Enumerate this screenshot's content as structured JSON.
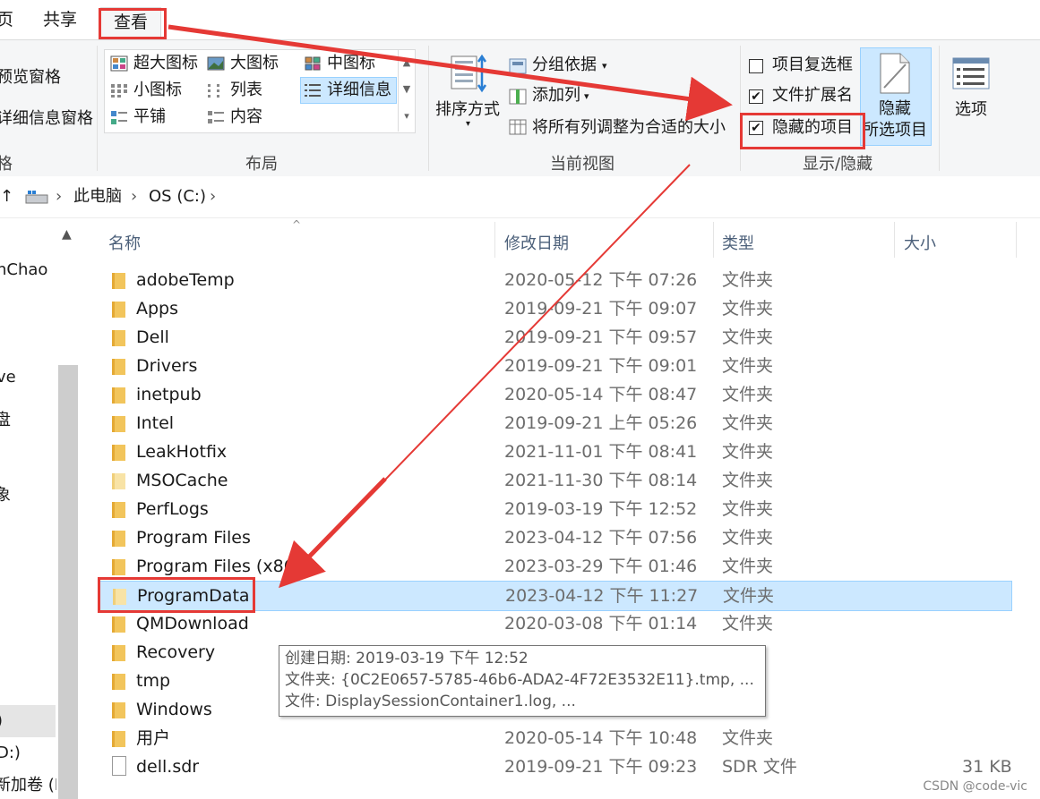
{
  "tabs": {
    "partial": "页",
    "share": "共享",
    "view": "查看"
  },
  "ribbon": {
    "pane_group": {
      "preview_pane": "预览窗格",
      "details_pane": "详细信息窗格",
      "group_label": "格"
    },
    "layout": {
      "items": [
        "超大图标",
        "大图标",
        "中图标",
        "小图标",
        "列表",
        "详细信息",
        "平铺",
        "内容"
      ],
      "group_label": "布局"
    },
    "current_view": {
      "sort_by": "排序方式",
      "group_by": "分组依据",
      "add_columns": "添加列",
      "size_all_columns": "将所有列调整为合适的大小",
      "group_label": "当前视图"
    },
    "show_hide": {
      "item_checkboxes": {
        "label": "项目复选框",
        "checked": false
      },
      "file_name_extensions": {
        "label": "文件扩展名",
        "checked": true
      },
      "hidden_items": {
        "label": "隐藏的项目",
        "checked": true
      },
      "hide_selected_line1": "隐藏",
      "hide_selected_line2": "所选项目",
      "group_label": "显示/隐藏"
    },
    "options": "选项"
  },
  "address": {
    "up_arrow": "↑",
    "crumb1": "此电脑",
    "crumb2": "OS (C:)"
  },
  "nav": {
    "items": [
      "nChao",
      "ve",
      "盘",
      "象",
      ")",
      "D:)",
      "新加卷 (E"
    ]
  },
  "columns": {
    "name": "名称",
    "modified": "修改日期",
    "type": "类型",
    "size": "大小"
  },
  "files": [
    {
      "name": "adobeTemp",
      "date": "2020-05-12 下午 07:26",
      "type": "文件夹",
      "size": "",
      "kind": "folder"
    },
    {
      "name": "Apps",
      "date": "2019-09-21 下午 09:07",
      "type": "文件夹",
      "size": "",
      "kind": "folder"
    },
    {
      "name": "Dell",
      "date": "2019-09-21 下午 09:57",
      "type": "文件夹",
      "size": "",
      "kind": "folder"
    },
    {
      "name": "Drivers",
      "date": "2019-09-21 下午 09:01",
      "type": "文件夹",
      "size": "",
      "kind": "folder"
    },
    {
      "name": "inetpub",
      "date": "2020-05-14 下午 08:47",
      "type": "文件夹",
      "size": "",
      "kind": "folder"
    },
    {
      "name": "Intel",
      "date": "2019-09-21 上午 05:26",
      "type": "文件夹",
      "size": "",
      "kind": "folder"
    },
    {
      "name": "LeakHotfix",
      "date": "2021-11-01 下午 08:41",
      "type": "文件夹",
      "size": "",
      "kind": "folder"
    },
    {
      "name": "MSOCache",
      "date": "2021-11-30 下午 08:14",
      "type": "文件夹",
      "size": "",
      "kind": "hidden"
    },
    {
      "name": "PerfLogs",
      "date": "2019-03-19 下午 12:52",
      "type": "文件夹",
      "size": "",
      "kind": "folder"
    },
    {
      "name": "Program Files",
      "date": "2023-04-12 下午 07:56",
      "type": "文件夹",
      "size": "",
      "kind": "folder"
    },
    {
      "name": "Program Files (x86)",
      "date": "2023-03-29 下午 01:46",
      "type": "文件夹",
      "size": "",
      "kind": "folder"
    },
    {
      "name": "ProgramData",
      "date": "2023-04-12 下午 11:27",
      "type": "文件夹",
      "size": "",
      "kind": "hidden",
      "selected": true
    },
    {
      "name": "QMDownload",
      "date": "2020-03-08 下午 01:14",
      "type": "文件夹",
      "size": "",
      "kind": "folder"
    },
    {
      "name": "Recovery",
      "date": "",
      "type": "",
      "size": "",
      "kind": "folder"
    },
    {
      "name": "tmp",
      "date": "",
      "type": "",
      "size": "",
      "kind": "folder"
    },
    {
      "name": "Windows",
      "date": "",
      "type": "",
      "size": "",
      "kind": "folder"
    },
    {
      "name": "用户",
      "date": "2020-05-14 下午 10:48",
      "type": "文件夹",
      "size": "",
      "kind": "folder"
    },
    {
      "name": "dell.sdr",
      "date": "2019-09-21 下午 09:23",
      "type": "SDR 文件",
      "size": "31 KB",
      "kind": "file"
    }
  ],
  "tooltip": {
    "line1": "创建日期: 2019-03-19 下午 12:52",
    "line2": "文件夹: {0C2E0657-5785-46b6-ADA2-4F72E3532E11}.tmp, ...",
    "line3": "文件: DisplaySessionContainer1.log, ..."
  },
  "watermark": "CSDN @code-vic",
  "colors": {
    "annotation_red": "#e53935",
    "selection_bg": "#cce8ff",
    "folder_yellow": "#f2c55c"
  }
}
